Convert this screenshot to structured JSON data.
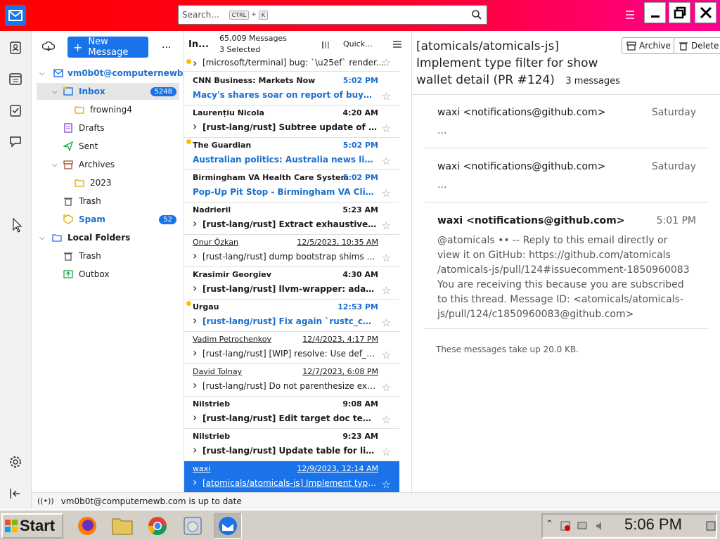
{
  "titlebar": {
    "search_placeholder": "Search...",
    "kbd_ctrl": "CTRL",
    "kbd_plus": "+",
    "kbd_k": "K"
  },
  "folders_pane": {
    "new_message": "New Message",
    "more": "...",
    "account": "vm0b0t@computernewb...",
    "items": [
      {
        "label": "Inbox",
        "badge": "5248"
      },
      {
        "label": "frowning4"
      },
      {
        "label": "Drafts"
      },
      {
        "label": "Sent"
      },
      {
        "label": "Archives"
      },
      {
        "label": "2023"
      },
      {
        "label": "Trash"
      },
      {
        "label": "Spam",
        "badge": "52"
      },
      {
        "label": "Local Folders"
      },
      {
        "label": "Trash"
      },
      {
        "label": "Outbox"
      }
    ]
  },
  "list_header": {
    "folder": "In...",
    "count": "65,009 Messages",
    "selected": "3 Selected",
    "quick": "Quick..."
  },
  "messages": [
    {
      "sender": "",
      "date": "",
      "subject": "[microsoft/terminal] bug: `\\u25ef` render..."
    },
    {
      "sender": "CNN Business: Markets Now",
      "date": "5:02 PM",
      "subject": "Macy's shares soar on report of buyout ..."
    },
    {
      "sender": "Laurențiu Nicola",
      "date": "4:20 AM",
      "subject": "[rust-lang/rust] Subtree update of `ru..."
    },
    {
      "sender": "The Guardian",
      "date": "5:02 PM",
      "subject": "Australian politics: Australia news live: ..."
    },
    {
      "sender": "Birmingham VA Health Care System",
      "date": "5:02 PM",
      "subject": "Pop-Up Pit Stop - Birmingham VA Clinic"
    },
    {
      "sender": "Nadrieril",
      "date": "5:23 AM",
      "subject": "[rust-lang/rust] Extract exhaustivenes..."
    },
    {
      "sender": "Onur Özkan",
      "date": "12/5/2023, 10:35 AM",
      "subject": "[rust-lang/rust] dump bootstrap shims (..."
    },
    {
      "sender": "Krasimir Georgiev",
      "date": "4:30 AM",
      "subject": "[rust-lang/rust] llvm-wrapper: adapt ..."
    },
    {
      "sender": "Urgau",
      "date": "12:53 PM",
      "subject": "[rust-lang/rust] Fix again `rustc_code..."
    },
    {
      "sender": "Vadim Petrochenkov",
      "date": "12/4/2023, 4:17 PM",
      "subject": "[rust-lang/rust] [WIP] resolve: Use def_ki..."
    },
    {
      "sender": "David Tolnay",
      "date": "12/7/2023, 6:08 PM",
      "subject": "[rust-lang/rust] Do not parenthesize ext..."
    },
    {
      "sender": "Nilstrieb",
      "date": "9:08 AM",
      "subject": "[rust-lang/rust] Edit target doc templ..."
    },
    {
      "sender": "Nilstrieb",
      "date": "9:23 AM",
      "subject": "[rust-lang/rust] Update table for link..."
    },
    {
      "sender": "waxi",
      "date": "12/9/2023, 12:14 AM",
      "subject": "[atomicals/atomicals-js] Implement type ..."
    }
  ],
  "reader": {
    "subject": "[atomicals/atomicals-js] Implement type filter for show wallet detail (PR #124)",
    "msg_count": "3 messages",
    "archive": "Archive",
    "delete": "Delete",
    "cards": [
      {
        "from": "waxi <notifications@github.com>",
        "when": "Saturday",
        "preview": "..."
      },
      {
        "from": "waxi <notifications@github.com>",
        "when": "Saturday",
        "preview": "..."
      },
      {
        "from": "waxi <notifications@github.com>",
        "when": "5:01 PM",
        "body": "@atomicals •• -- Reply to this email directly or view it on GitHub: https://github.com/atomicals /atomicals-js/pull/124#issuecomment-1850960083 You are receiving this because you are subscribed to this thread. Message ID: <atomicals/atomicals-js/pull/124/c1850960083@github.com>"
      }
    ],
    "size_note": "These messages take up 20.0 KB."
  },
  "status": {
    "text": "vm0b0t@computernewb.com is up to date"
  },
  "taskbar": {
    "start": "Start",
    "clock": "5:06 PM"
  }
}
